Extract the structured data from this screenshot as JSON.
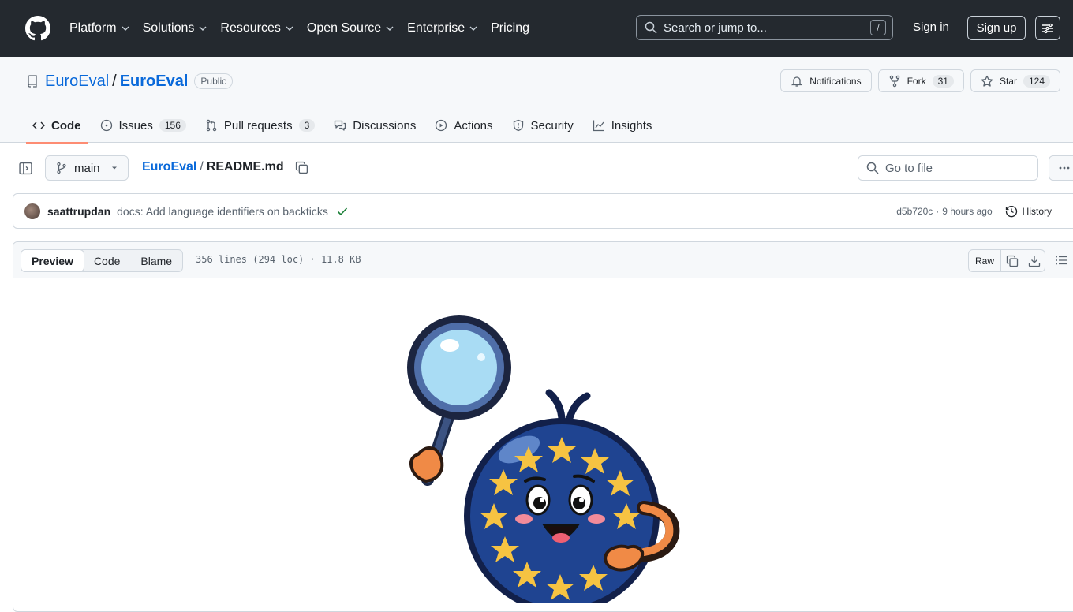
{
  "header": {
    "nav": [
      "Platform",
      "Solutions",
      "Resources",
      "Open Source",
      "Enterprise",
      "Pricing"
    ],
    "search_placeholder": "Search or jump to...",
    "search_shortcut": "/",
    "signin": "Sign in",
    "signup": "Sign up"
  },
  "repo": {
    "owner": "EuroEval",
    "separator": "/",
    "name": "EuroEval",
    "visibility": "Public",
    "notifications": "Notifications",
    "fork_label": "Fork",
    "fork_count": "31",
    "star_label": "Star",
    "star_count": "124"
  },
  "tabs": [
    {
      "label": "Code",
      "count": ""
    },
    {
      "label": "Issues",
      "count": "156"
    },
    {
      "label": "Pull requests",
      "count": "3"
    },
    {
      "label": "Discussions",
      "count": ""
    },
    {
      "label": "Actions",
      "count": ""
    },
    {
      "label": "Security",
      "count": ""
    },
    {
      "label": "Insights",
      "count": ""
    }
  ],
  "filenav": {
    "branch": "main",
    "crumb_repo": "EuroEval",
    "crumb_sep": "/",
    "crumb_file": "README.md",
    "goto_placeholder": "Go to file"
  },
  "commit": {
    "author": "saattrupdan",
    "message": "docs: Add language identifiers on backticks",
    "sha": "d5b720c",
    "dot": "·",
    "time": "9 hours ago",
    "history": "History"
  },
  "file": {
    "views": [
      "Preview",
      "Code",
      "Blame"
    ],
    "meta": "356 lines (294 loc) · 11.8 KB",
    "raw": "Raw"
  },
  "colors": {
    "header_bg": "#24292f",
    "link": "#0969da",
    "tab_underline": "#fd8c73",
    "check": "#1a7f37"
  }
}
